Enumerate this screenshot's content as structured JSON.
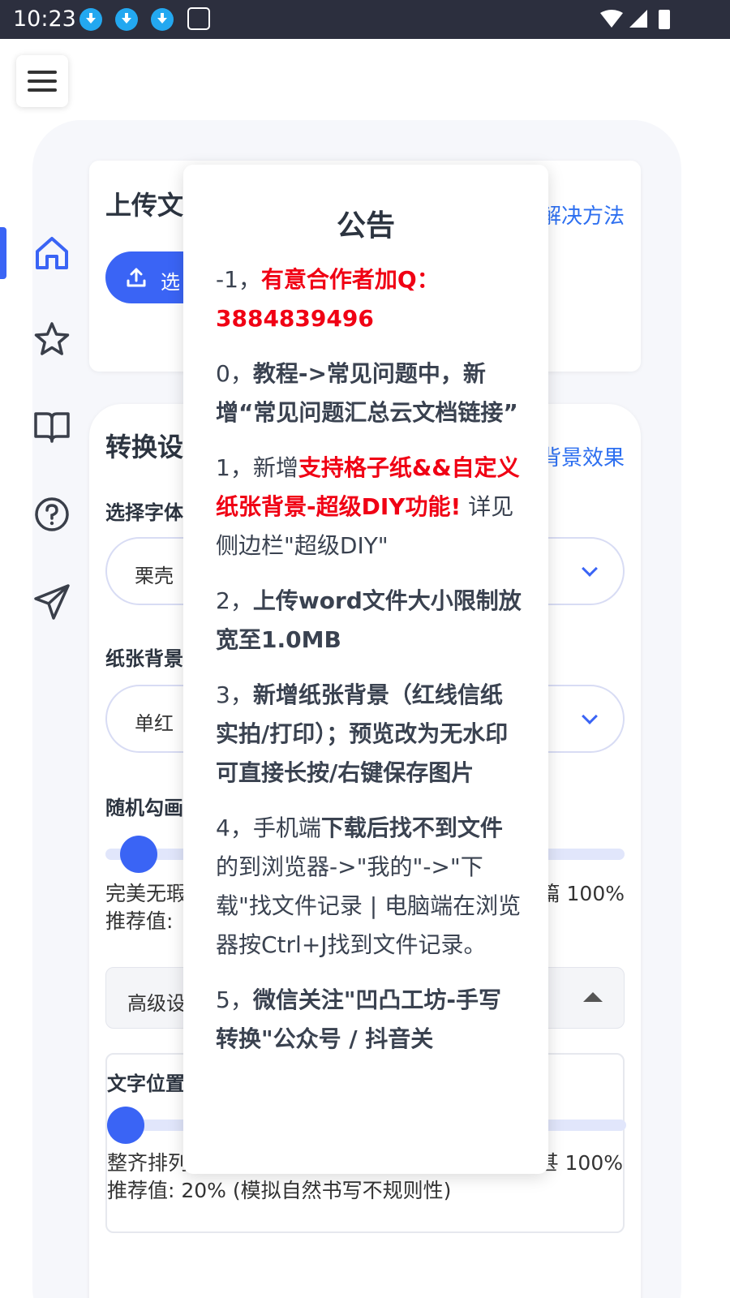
{
  "status_bar": {
    "time": "10:23"
  },
  "upload_card": {
    "title": "上传文",
    "link": "解决方法",
    "button_label": "选"
  },
  "settings_card": {
    "title": "转换设",
    "link": "背景效果",
    "font_label": "选择字体",
    "font_value": "栗壳",
    "paper_label": "纸张背景",
    "paper_value": "单红",
    "random_label": "随机勾画",
    "slider1": {
      "value_percent": 0,
      "left_text": "完美无瑕",
      "right_text": "篇 100%",
      "hint": "推荐值:"
    },
    "advanced_label": "高级设",
    "text_pos_label": "文字位置",
    "slider2": {
      "value_percent": 0,
      "left_text": "整齐排列",
      "right_text": "甚 100%",
      "hint": "推荐值: 20% (模拟自然书写不规则性)"
    }
  },
  "modal": {
    "title": "公告",
    "items": [
      {
        "prefix": "-1，",
        "red": "有意合作者加Q：3884839496"
      },
      {
        "prefix": "0，",
        "bold": "教程->常见问题中，新增“常见问题汇总云文档链接”"
      },
      {
        "prefix": "1，新增",
        "red": "支持格子纸&&自定义纸张背景-超级DIY功能!",
        "rest": " 详见侧边栏\"超级DIY\""
      },
      {
        "prefix": "2，",
        "bold": "上传word文件大小限制放宽至1.0MB"
      },
      {
        "prefix": "3，",
        "bold": "新增纸张背景（红线信纸实拍/打印）；预览改为无水印可直接长按/右键保存图片"
      },
      {
        "prefix": "4，手机端",
        "bold": "下载后找不到文件",
        "rest": "的到浏览器->\"我的\"->\"下载\"找文件记录 | 电脑端在浏览器按Ctrl+J找到文件记录。"
      },
      {
        "prefix": "5，",
        "bold": "微信关注\"凹凸工坊-手写转换\"公众号 / 抖音关"
      }
    ]
  }
}
